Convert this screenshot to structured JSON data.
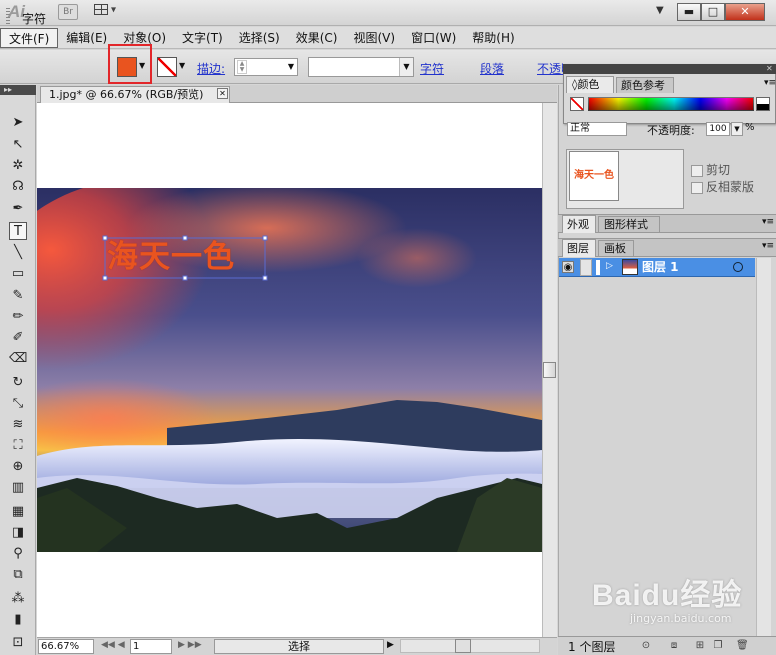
{
  "app": {
    "logo": "Ai",
    "bridge": "Br",
    "doc_tab": "1.jpg* @ 66.67% (RGB/预览)"
  },
  "menu": [
    "文件(F)",
    "编辑(E)",
    "对象(O)",
    "文字(T)",
    "选择(S)",
    "效果(C)",
    "视图(V)",
    "窗口(W)",
    "帮助(H)"
  ],
  "control": {
    "mode_label": "字符",
    "stroke_link": "描边:",
    "char_link": "字符",
    "para_link": "段落",
    "opacity_link": "不透明度"
  },
  "colors": {
    "fill": "#e9541f",
    "accent_highlight": "#e2262a",
    "layer_selected": "#4a8fe4"
  },
  "artwork": {
    "text": "海天一色"
  },
  "status": {
    "zoom": "66.67%",
    "page": "1",
    "tool": "选择"
  },
  "panels": {
    "color_tab": "颜色",
    "color_guide_tab": "颜色参考",
    "blend_mode": "正常",
    "opacity_label": "不透明度:",
    "opacity_value": "100",
    "opacity_unit": "%",
    "thumb_text": "海天一色",
    "clip_label": "剪切",
    "invert_label": "反相蒙版",
    "appearance_tab": "外观",
    "graphic_styles_tab": "图形样式",
    "layers_tab": "图层",
    "artboards_tab": "画板",
    "layer_name": "图层 1",
    "layer_count": "1 个图层"
  },
  "watermark": {
    "main": "Baidu经验",
    "sub": "jingyan.baidu.com"
  }
}
